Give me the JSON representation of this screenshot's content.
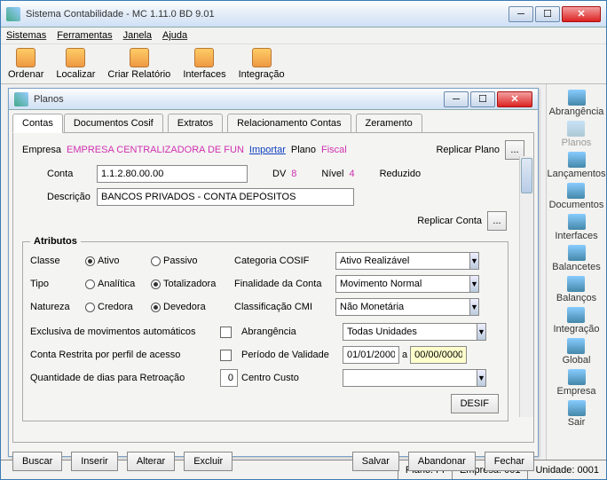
{
  "app": {
    "title": "Sistema Contabilidade -  MC 1.11.0 BD 9.01"
  },
  "menu": [
    "Sistemas",
    "Ferramentas",
    "Janela",
    "Ajuda"
  ],
  "toolbar": [
    "Ordenar",
    "Localizar",
    "Criar Relatório",
    "Interfaces",
    "Integração"
  ],
  "rightbar": [
    {
      "label": "Abrangência",
      "dim": false
    },
    {
      "label": "Planos",
      "dim": true
    },
    {
      "label": "Lançamentos",
      "dim": false
    },
    {
      "label": "Documentos",
      "dim": false
    },
    {
      "label": "Interfaces",
      "dim": false
    },
    {
      "label": "Balancetes",
      "dim": false
    },
    {
      "label": "Balanços",
      "dim": false
    },
    {
      "label": "Integração",
      "dim": false
    },
    {
      "label": "Global",
      "dim": false
    },
    {
      "label": "Empresa",
      "dim": false
    },
    {
      "label": "Sair",
      "dim": false
    }
  ],
  "mdi": {
    "title": "Planos",
    "tabs": [
      "Contas",
      "Documentos Cosif",
      "Extratos",
      "Relacionamento Contas",
      "Zeramento"
    ],
    "active_tab": 0,
    "empresa_lbl": "Empresa",
    "empresa_val": "EMPRESA CENTRALIZADORA DE FUN",
    "importar": "Importar",
    "plano_lbl": "Plano",
    "plano_val": "Fiscal",
    "replicar_plano": "Replicar Plano",
    "conta_lbl": "Conta",
    "conta_val": "1.1.2.80.00.00",
    "dv_lbl": "DV",
    "dv_val": "8",
    "nivel_lbl": "Nível",
    "nivel_val": "4",
    "reduzido_lbl": "Reduzido",
    "descricao_lbl": "Descrição",
    "descricao_val": "BANCOS PRIVADOS - CONTA DEPÓSITOS",
    "replicar_conta": "Replicar Conta",
    "atributos": {
      "legend": "Atributos",
      "classe_lbl": "Classe",
      "classe_opts": [
        "Ativo",
        "Passivo"
      ],
      "classe_sel": 0,
      "tipo_lbl": "Tipo",
      "tipo_opts": [
        "Analítica",
        "Totalizadora"
      ],
      "tipo_sel": 1,
      "natureza_lbl": "Natureza",
      "natureza_opts": [
        "Credora",
        "Devedora"
      ],
      "natureza_sel": 1,
      "categoria_lbl": "Categoria COSIF",
      "categoria_val": "Ativo Realizável",
      "finalidade_lbl": "Finalidade da Conta",
      "finalidade_val": "Movimento Normal",
      "classif_lbl": "Classificação CMI",
      "classif_val": "Não Monetária",
      "exclusiva_lbl": "Exclusiva de movimentos automáticos",
      "abrangencia_lbl": "Abrangência",
      "abrangencia_val": "Todas Unidades",
      "restrita_lbl": "Conta Restrita por perfil de acesso",
      "periodo_lbl": "Período de Validade",
      "periodo_from": "01/01/2000",
      "periodo_sep": "a",
      "periodo_to": "00/00/0000",
      "retroacao_lbl": "Quantidade de dias para Retroação",
      "retroacao_val": "0",
      "centro_lbl": "Centro Custo",
      "desif": "DESIF"
    },
    "buttons": [
      "Buscar",
      "Inserir",
      "Alterar",
      "Excluir",
      "Salvar",
      "Abandonar",
      "Fechar"
    ]
  },
  "status": {
    "plano": "Plano:    FI",
    "empresa": "Empresa: 001",
    "unidade": "Unidade: 0001"
  }
}
